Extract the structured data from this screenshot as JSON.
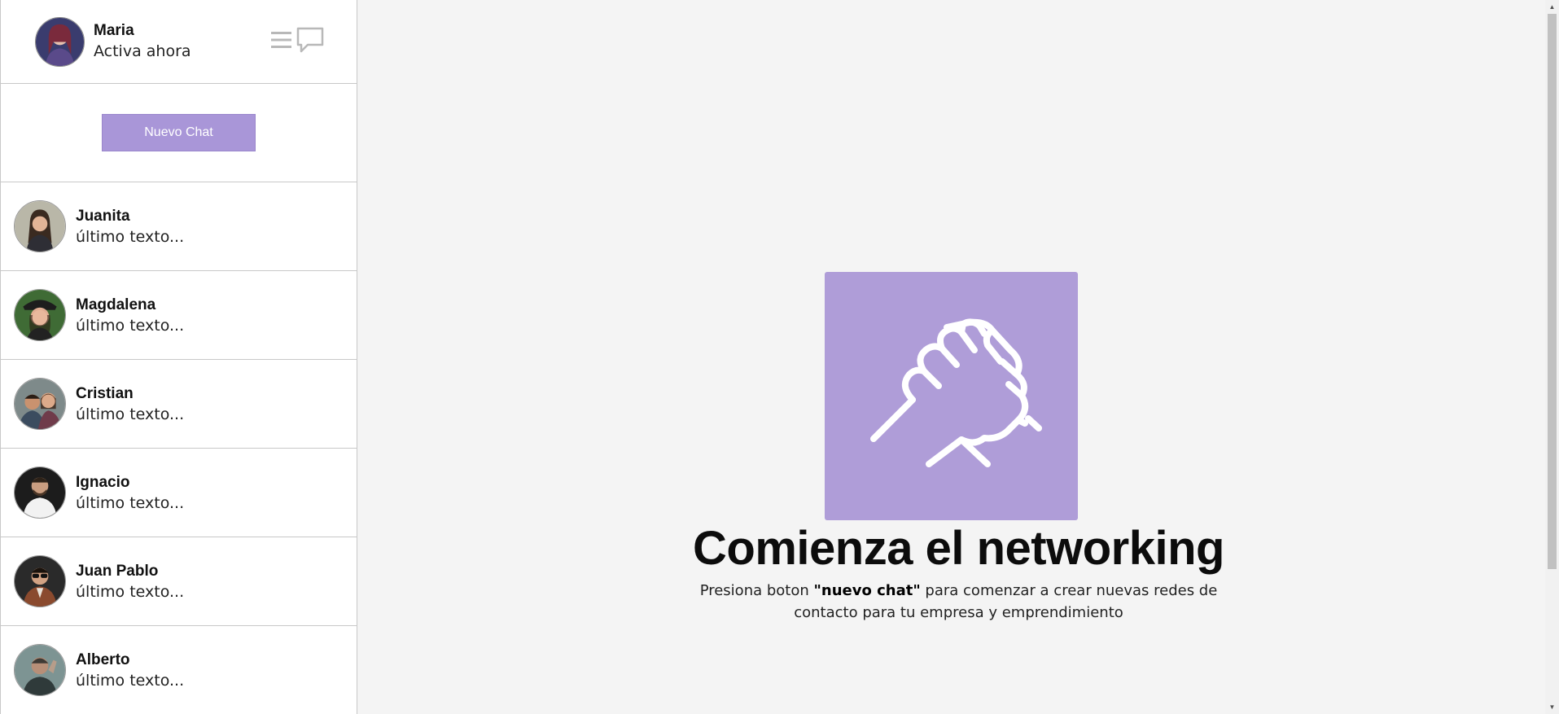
{
  "profile": {
    "name": "Maria",
    "status": "Activa ahora"
  },
  "new_chat_button": "Nuevo Chat",
  "contacts": [
    {
      "name": "Juanita",
      "last": "último texto..."
    },
    {
      "name": "Magdalena",
      "last": "último texto..."
    },
    {
      "name": "Cristian",
      "last": "último texto..."
    },
    {
      "name": "Ignacio",
      "last": "último texto..."
    },
    {
      "name": "Juan Pablo",
      "last": "último texto..."
    },
    {
      "name": "Alberto",
      "last": "último texto..."
    }
  ],
  "hero": {
    "icon": "handshake-icon",
    "title": "Comienza el networking",
    "text_before": "Presiona boton ",
    "text_bold": "\"nuevo chat\"",
    "text_after": " para comenzar a crear nuevas redes de contacto para tu empresa y emprendimiento"
  },
  "colors": {
    "accent": "#af9dd8",
    "button": "#a996d8",
    "background": "#f4f4f4"
  }
}
